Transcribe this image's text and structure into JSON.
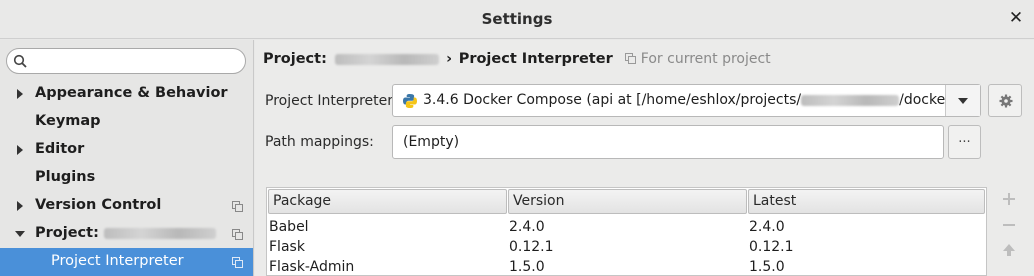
{
  "window": {
    "title": "Settings"
  },
  "sidebar": {
    "search": {
      "value": "",
      "placeholder": ""
    },
    "items": [
      {
        "label": "Appearance & Behavior",
        "expandable": true,
        "expanded": false
      },
      {
        "label": "Keymap",
        "expandable": false
      },
      {
        "label": "Editor",
        "expandable": true,
        "expanded": false
      },
      {
        "label": "Plugins",
        "expandable": false
      },
      {
        "label": "Version Control",
        "expandable": true,
        "expanded": false
      },
      {
        "label": "Project:",
        "expandable": true,
        "expanded": true
      },
      {
        "label": "Project Interpreter",
        "selected": true
      }
    ]
  },
  "main": {
    "breadcrumb": {
      "root": "Project:",
      "separator": "›",
      "current": "Project Interpreter",
      "scope": "For current project"
    },
    "interpreter": {
      "label": "Project Interpreter:",
      "value_prefix": "3.4.6 Docker Compose (api at [/home/eshlox/projects/",
      "value_suffix": "/docker-..."
    },
    "path_mappings": {
      "label": "Path mappings:",
      "value": "(Empty)",
      "button_label": "..."
    },
    "packages": {
      "columns": [
        "Package",
        "Version",
        "Latest"
      ],
      "rows": [
        {
          "package": "Babel",
          "version": "2.4.0",
          "latest": "2.4.0"
        },
        {
          "package": "Flask",
          "version": "0.12.1",
          "latest": "0.12.1"
        },
        {
          "package": "Flask-Admin",
          "version": "1.5.0",
          "latest": "1.5.0"
        }
      ]
    }
  },
  "colors": {
    "selection": "#4a90d9",
    "background": "#ebebea"
  }
}
